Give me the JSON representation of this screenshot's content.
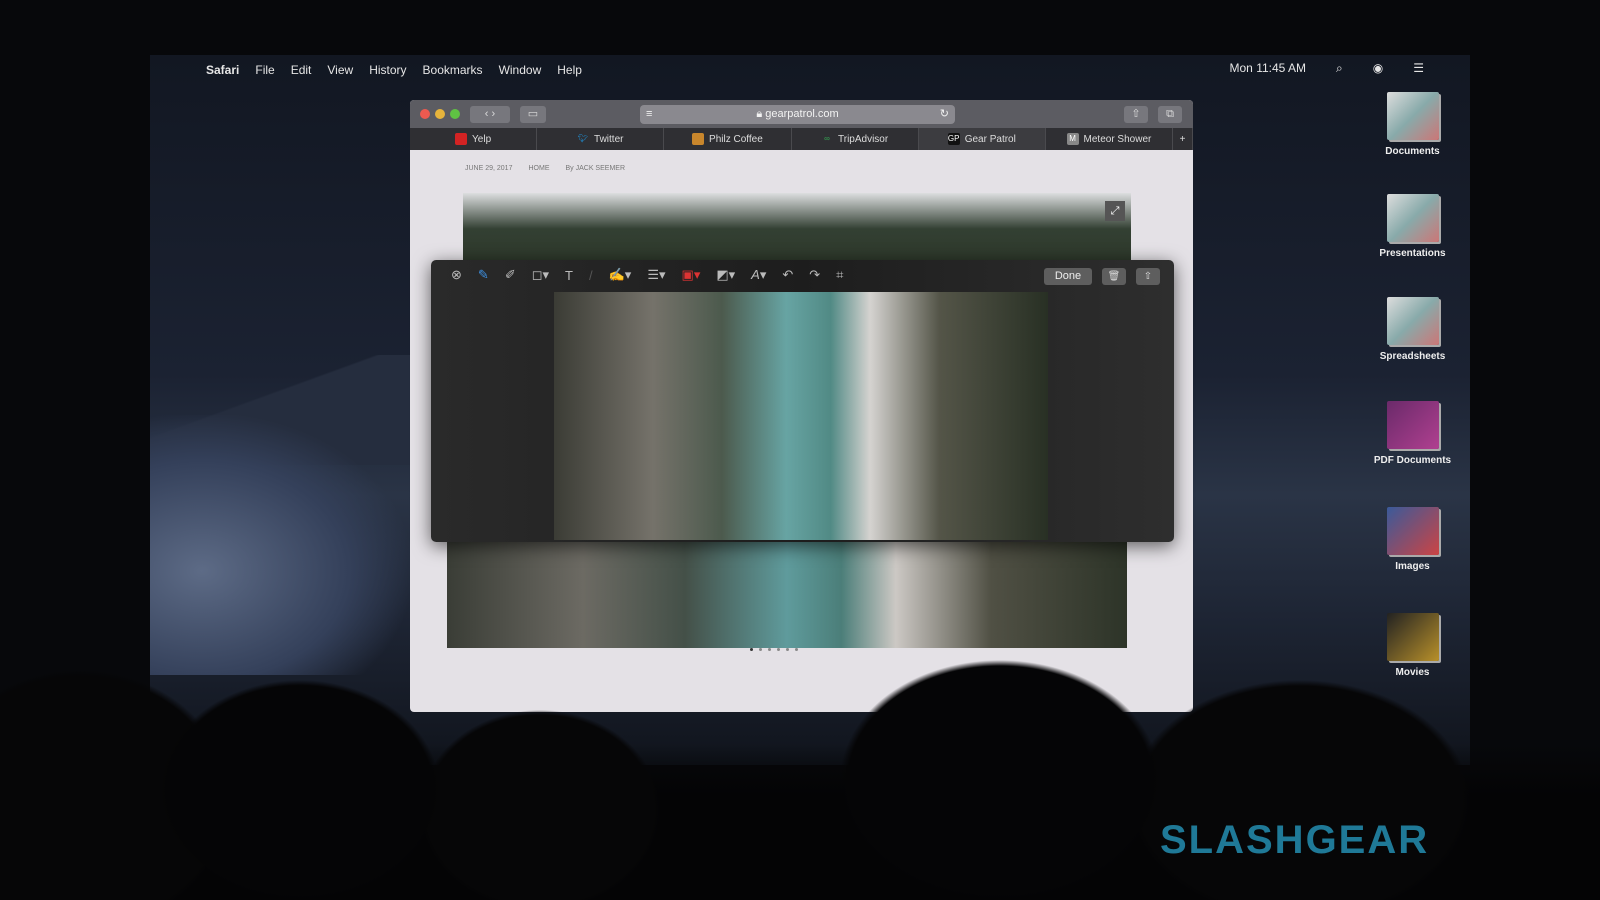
{
  "menubar": {
    "apple": "",
    "app": "Safari",
    "items": [
      "File",
      "Edit",
      "View",
      "History",
      "Bookmarks",
      "Window",
      "Help"
    ],
    "clock": "Mon 11:45 AM"
  },
  "safari": {
    "url": "gearpatrol.com",
    "tabs": [
      {
        "label": "Yelp",
        "icon": "Y",
        "color": "#d32323"
      },
      {
        "label": "Twitter",
        "icon": "t",
        "color": "#1da1f2"
      },
      {
        "label": "Philz Coffee",
        "icon": "P",
        "color": "#c8862c"
      },
      {
        "label": "TripAdvisor",
        "icon": "oo",
        "color": "#34a853"
      },
      {
        "label": "Gear Patrol",
        "icon": "GP",
        "color": "#111111",
        "active": true
      },
      {
        "label": "Meteor Shower",
        "icon": "M",
        "color": "#888888"
      }
    ],
    "article": {
      "date": "JUNE 29, 2017",
      "section": "HOME",
      "byline": "By JACK SEEMER"
    }
  },
  "markup": {
    "done": "Done",
    "tools": [
      "close",
      "sketch",
      "draw",
      "shapes",
      "text",
      "highlight",
      "sign",
      "line-style",
      "border-color",
      "fill-color",
      "text-style",
      "rotate-left",
      "rotate-right",
      "crop"
    ]
  },
  "desktop": [
    "Documents",
    "Presentations",
    "Spreadsheets",
    "PDF Documents",
    "Images",
    "Movies"
  ],
  "watermark": "SLASHGEAR"
}
